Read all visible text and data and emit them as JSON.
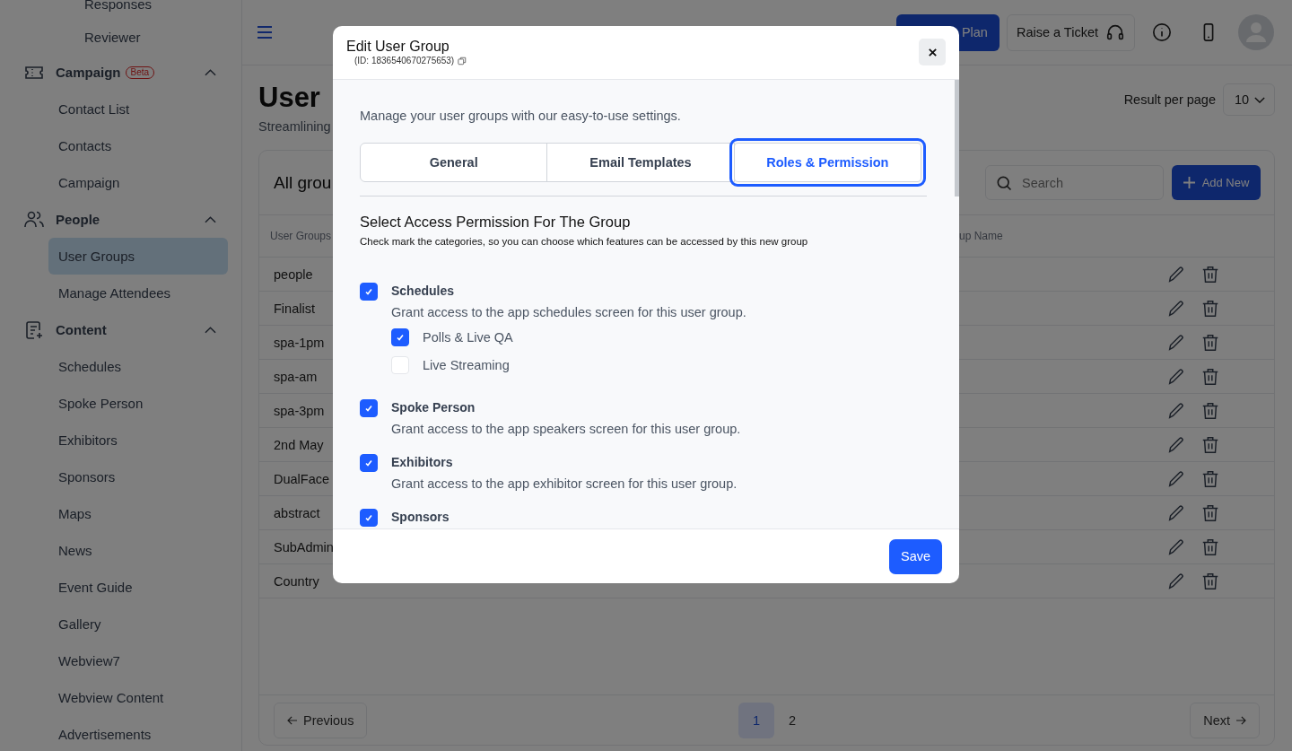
{
  "sidebar": {
    "scrolled_children": [
      "Responses",
      "Reviewer"
    ],
    "groups": [
      {
        "label": "Campaign",
        "badge": "Beta",
        "expanded": true,
        "children": [
          {
            "label": "Contact List",
            "selected": false
          },
          {
            "label": "Contacts",
            "selected": false
          },
          {
            "label": "Campaign",
            "selected": false
          }
        ]
      },
      {
        "label": "People",
        "expanded": true,
        "children": [
          {
            "label": "User Groups",
            "selected": true
          },
          {
            "label": "Manage Attendees",
            "selected": false
          }
        ]
      },
      {
        "label": "Content",
        "expanded": true,
        "children": [
          {
            "label": "Schedules",
            "selected": false
          },
          {
            "label": "Spoke Person",
            "selected": false
          },
          {
            "label": "Exhibitors",
            "selected": false
          },
          {
            "label": "Sponsors",
            "selected": false
          },
          {
            "label": "Maps",
            "selected": false
          },
          {
            "label": "News",
            "selected": false
          },
          {
            "label": "Event Guide",
            "selected": false
          },
          {
            "label": "Gallery",
            "selected": false
          },
          {
            "label": "Webview7",
            "selected": false
          },
          {
            "label": "Webview Content",
            "selected": false
          },
          {
            "label": "Advertisements",
            "selected": false
          }
        ]
      }
    ]
  },
  "topbar": {
    "plan_button": "Plan",
    "ticket_button": "Raise a Ticket"
  },
  "page": {
    "title": "User",
    "subtitle": "Streamlining",
    "result_per_page": {
      "label": "Result per page",
      "value": "10"
    }
  },
  "card": {
    "title": "All grou",
    "search": {
      "placeholder": "Search"
    },
    "add_button": "Add New",
    "columns": [
      "User Groups",
      "up Name"
    ],
    "rows": [
      {
        "name": "people"
      },
      {
        "name": "Finalist"
      },
      {
        "name": "spa-1pm"
      },
      {
        "name": "spa-am"
      },
      {
        "name": "spa-3pm"
      },
      {
        "name": "2nd May"
      },
      {
        "name": "DualFace"
      },
      {
        "name": "abstract"
      },
      {
        "name": "SubAdmin"
      },
      {
        "name": "Country"
      }
    ],
    "pagination": {
      "previous": "Previous",
      "next": "Next",
      "pages": [
        {
          "label": "1",
          "selected": true
        },
        {
          "label": "2",
          "selected": false
        }
      ]
    }
  },
  "modal": {
    "title": "Edit User Group",
    "id_text": "(ID: 1836540670275653)",
    "intro": "Manage your user groups with our easy-to-use settings.",
    "tabs": [
      {
        "label": "General",
        "selected": false
      },
      {
        "label": "Email Templates",
        "selected": false
      },
      {
        "label": "Roles & Permission",
        "selected": true
      }
    ],
    "heading": "Select Access Permission For The Group",
    "subheading": "Check mark the categories, so you can choose which features can be accessed by this new group",
    "permissions": [
      {
        "label": "Schedules",
        "description": "Grant access to the app schedules screen for this user group.",
        "checked": true,
        "children": [
          {
            "label": "Polls & Live QA",
            "checked": true
          },
          {
            "label": "Live Streaming",
            "checked": false
          }
        ]
      },
      {
        "label": "Spoke Person",
        "description": "Grant access to the app speakers screen for this user group.",
        "checked": true
      },
      {
        "label": "Exhibitors",
        "description": "Grant access to the app exhibitor screen for this user group.",
        "checked": true
      },
      {
        "label": "Sponsors",
        "checked": true
      }
    ],
    "save_button": "Save"
  }
}
